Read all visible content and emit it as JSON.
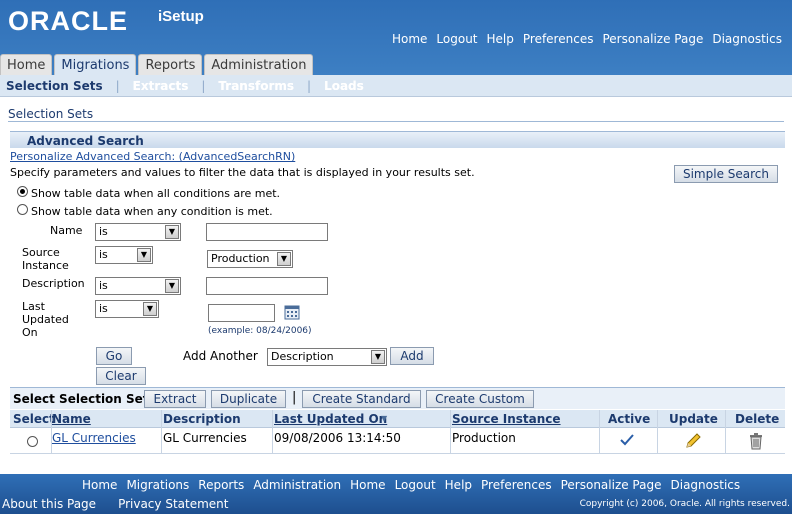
{
  "brand": {
    "logo": "ORACLE",
    "product": "iSetup"
  },
  "global_links": [
    "Home",
    "Logout",
    "Help",
    "Preferences",
    "Personalize Page",
    "Diagnostics"
  ],
  "tabs": [
    "Home",
    "Migrations",
    "Reports",
    "Administration"
  ],
  "subtabs": [
    "Selection Sets",
    "Extracts",
    "Transforms",
    "Loads"
  ],
  "page_title": "Selection Sets",
  "advanced_search": {
    "header": "Advanced Search",
    "personalize_link": "Personalize Advanced Search: (AdvancedSearchRN)",
    "instructions": "Specify parameters and values to filter the data that is displayed in your results set.",
    "simple_search": "Simple Search",
    "radio_all": "Show table data when all conditions are met.",
    "radio_any": "Show table data when any condition is met.",
    "rows": {
      "name_label": "Name",
      "name_op": "is",
      "source_label": "Source Instance",
      "source_op": "is",
      "source_value": "Production",
      "desc_label": "Description",
      "desc_op": "is",
      "updated_label": "Last Updated On",
      "updated_op": "is",
      "date_example": "(example: 08/24/2006)"
    },
    "go": "Go",
    "clear": "Clear",
    "add_another_label": "Add Another",
    "add_another_value": "Description",
    "add": "Add"
  },
  "table_actions": {
    "label": "Select Selection Set:",
    "extract": "Extract",
    "duplicate": "Duplicate",
    "create_standard": "Create Standard",
    "create_custom": "Create Custom"
  },
  "table": {
    "columns": [
      "Select",
      "Name",
      "Description",
      "Last Updated On",
      "Source Instance",
      "Active",
      "Update",
      "Delete"
    ],
    "rows": [
      {
        "name": "GL Currencies",
        "description": "GL Currencies",
        "last_updated": "09/08/2006 13:14:50",
        "source": "Production"
      }
    ]
  },
  "footer": {
    "links": [
      "Home",
      "Migrations",
      "Reports",
      "Administration",
      "Home",
      "Logout",
      "Help",
      "Preferences",
      "Personalize Page",
      "Diagnostics"
    ],
    "about": "About this Page",
    "privacy": "Privacy Statement",
    "copyright": "Copyright (c) 2006, Oracle. All rights reserved."
  }
}
